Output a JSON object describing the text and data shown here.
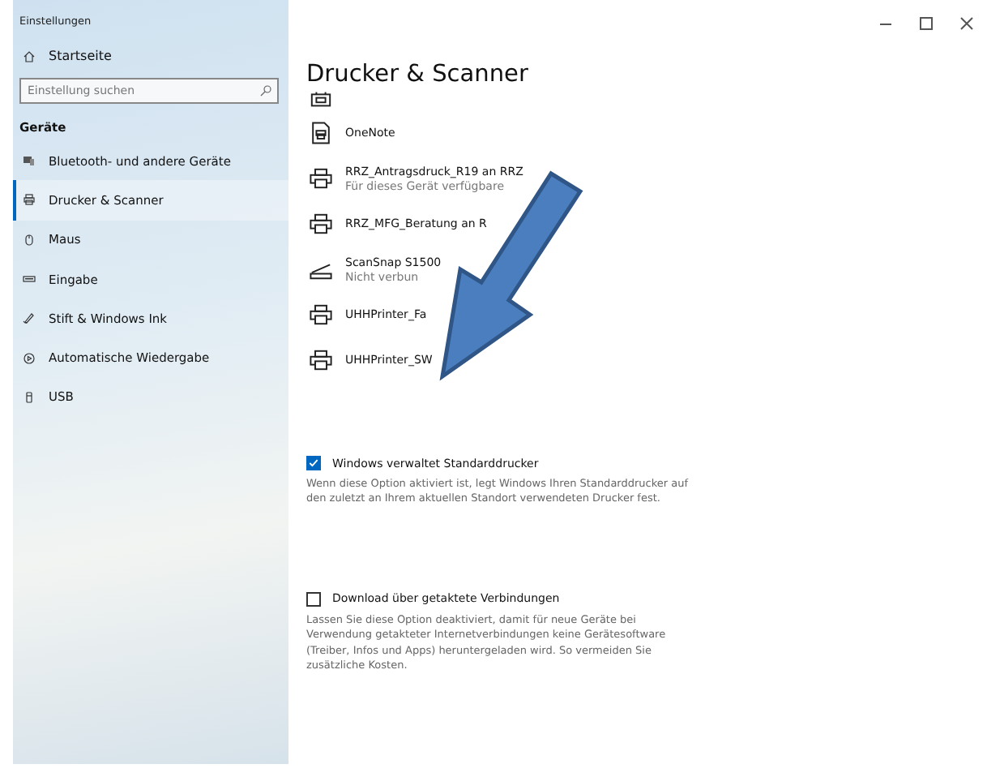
{
  "window": {
    "title": "Einstellungen"
  },
  "sidebar": {
    "home": "Startseite",
    "search": {
      "placeholder": "Einstellung suchen"
    },
    "section": "Geräte",
    "items": [
      {
        "label": "Bluetooth- und andere Geräte",
        "kind": "bluetooth",
        "selected": false
      },
      {
        "label": "Drucker & Scanner",
        "kind": "printer",
        "selected": true
      },
      {
        "label": "Maus",
        "kind": "mouse",
        "selected": false
      },
      {
        "label": "Eingabe",
        "kind": "keyboard",
        "selected": false
      },
      {
        "label": "Stift & Windows Ink",
        "kind": "pen",
        "selected": false
      },
      {
        "label": "Automatische Wiedergabe",
        "kind": "autoplay",
        "selected": false
      },
      {
        "label": "USB",
        "kind": "usb",
        "selected": false
      }
    ]
  },
  "page": {
    "title": "Drucker & Scanner",
    "devices": [
      {
        "kind": "fax"
      },
      {
        "name": "OneNote",
        "kind": "document"
      },
      {
        "name": "RRZ_Antragsdruck_R19 an RRZ",
        "status": "Für dieses Gerät verfügbare",
        "kind": "printer"
      },
      {
        "name": "RRZ_MFG_Beratung an R",
        "kind": "printer"
      },
      {
        "name": "ScanSnap S1500",
        "status": "Nicht verbun",
        "kind": "scanner"
      },
      {
        "name": "UHHPrinter_Fa",
        "kind": "printer"
      },
      {
        "name": "UHHPrinter_SW",
        "kind": "printer"
      }
    ],
    "options": [
      {
        "label": "Windows verwaltet Standarddrucker",
        "checked": true,
        "description": "Wenn diese Option aktiviert ist, legt Windows Ihren Standarddrucker auf den zuletzt an Ihrem aktuellen Standort verwendeten Drucker fest."
      },
      {
        "label": "Download über getaktete Verbindungen",
        "checked": false,
        "description": "Lassen Sie diese Option deaktiviert, damit für neue Geräte bei Verwendung getakteter Internetverbindungen keine Gerätesoftware (Treiber, Infos und Apps) heruntergeladen wird. So vermeiden Sie zusätzliche Kosten."
      }
    ]
  }
}
